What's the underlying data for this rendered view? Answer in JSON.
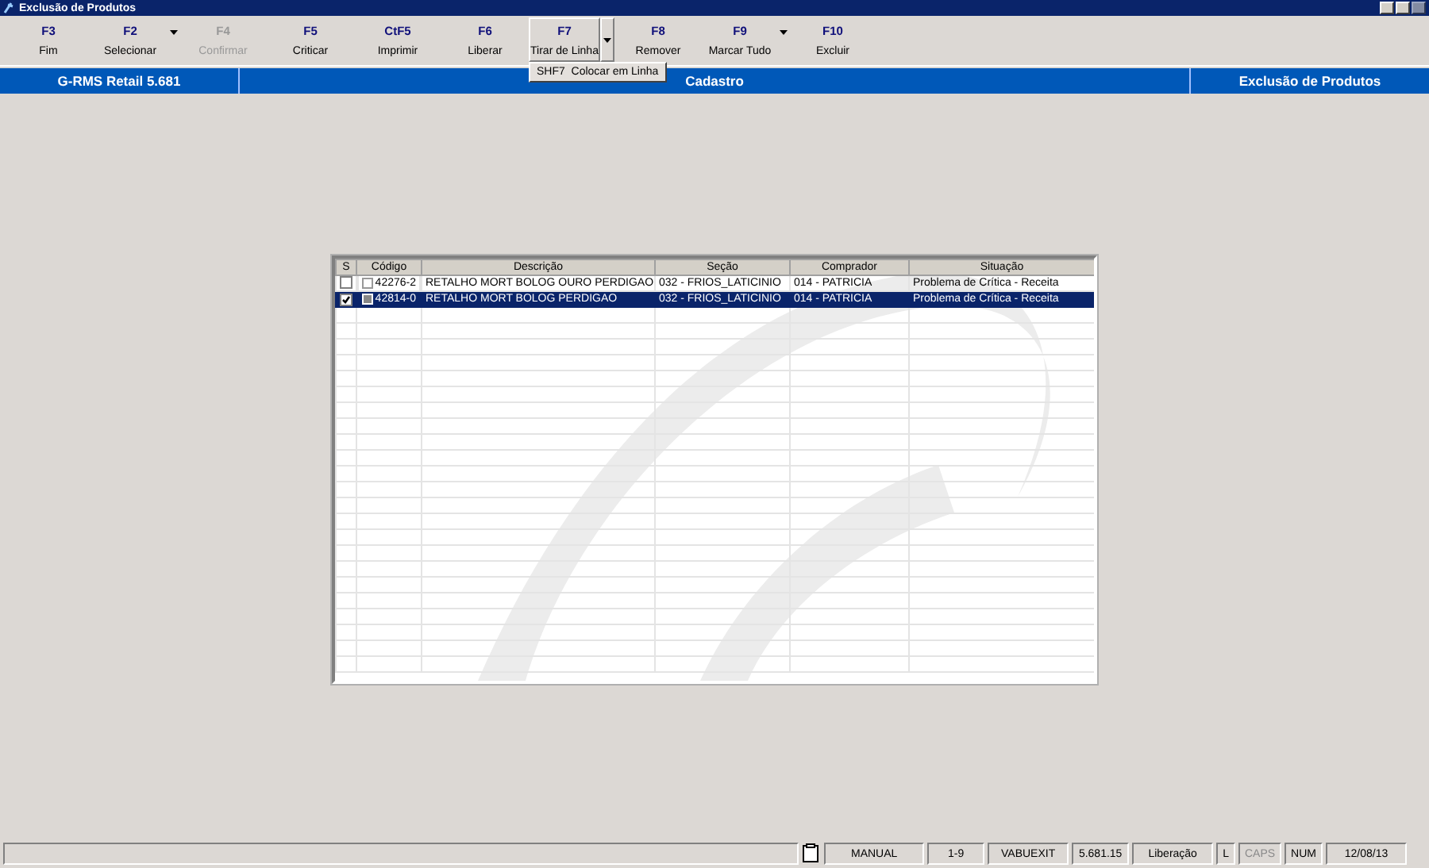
{
  "window": {
    "title": "Exclusão de Produtos"
  },
  "toolbar": [
    {
      "key": "F3",
      "label": "Fim",
      "disabled": false,
      "dropdown": false,
      "pressed": false
    },
    {
      "key": "F2",
      "label": "Selecionar",
      "disabled": false,
      "dropdown": true,
      "pressed": false
    },
    {
      "key": "F4",
      "label": "Confirmar",
      "disabled": true,
      "dropdown": false,
      "pressed": false
    },
    {
      "key": "F5",
      "label": "Criticar",
      "disabled": false,
      "dropdown": false,
      "pressed": false
    },
    {
      "key": "CtF5",
      "label": "Imprimir",
      "disabled": false,
      "dropdown": false,
      "pressed": false
    },
    {
      "key": "F6",
      "label": "Liberar",
      "disabled": false,
      "dropdown": false,
      "pressed": false
    },
    {
      "key": "F7",
      "label": "Tirar de Linha",
      "disabled": false,
      "dropdown": true,
      "pressed": true,
      "menu": [
        "SHF7  Colocar em Linha"
      ]
    },
    {
      "key": "F8",
      "label": "Remover",
      "disabled": false,
      "dropdown": false,
      "pressed": false
    },
    {
      "key": "F9",
      "label": "Marcar Tudo",
      "disabled": false,
      "dropdown": true,
      "pressed": false
    },
    {
      "key": "F10",
      "label": "Excluir",
      "disabled": false,
      "dropdown": false,
      "pressed": false
    }
  ],
  "header_bar": {
    "product": "G-RMS Retail 5.681",
    "module": "Cadastro",
    "screen": "Exclusão de Produtos"
  },
  "table": {
    "columns": [
      "S",
      "Código",
      "Descrição",
      "Seção",
      "Comprador",
      "Situação"
    ],
    "rows": [
      {
        "checked": false,
        "flagged": false,
        "selected": false,
        "cells": [
          "",
          "42276-2",
          "RETALHO MORT BOLOG OURO PERDIGAO",
          "032 - FRIOS_LATICINIO",
          "014 - PATRICIA",
          "Problema de Crítica - Receita"
        ]
      },
      {
        "checked": true,
        "flagged": true,
        "selected": true,
        "cells": [
          "",
          "42814-0",
          "RETALHO MORT BOLOG PERDIGAO",
          "032 - FRIOS_LATICINIO",
          "014 - PATRICIA",
          "Problema de Crítica - Receita"
        ]
      }
    ]
  },
  "status_bar": {
    "panels": [
      "MANUAL",
      "1-9",
      "VABUEXIT",
      "5.681.15",
      "Liberação"
    ],
    "indicators": [
      {
        "label": "L",
        "on": true
      },
      {
        "label": "CAPS",
        "on": false
      },
      {
        "label": "NUM",
        "on": true
      }
    ],
    "date": "12/08/13"
  }
}
